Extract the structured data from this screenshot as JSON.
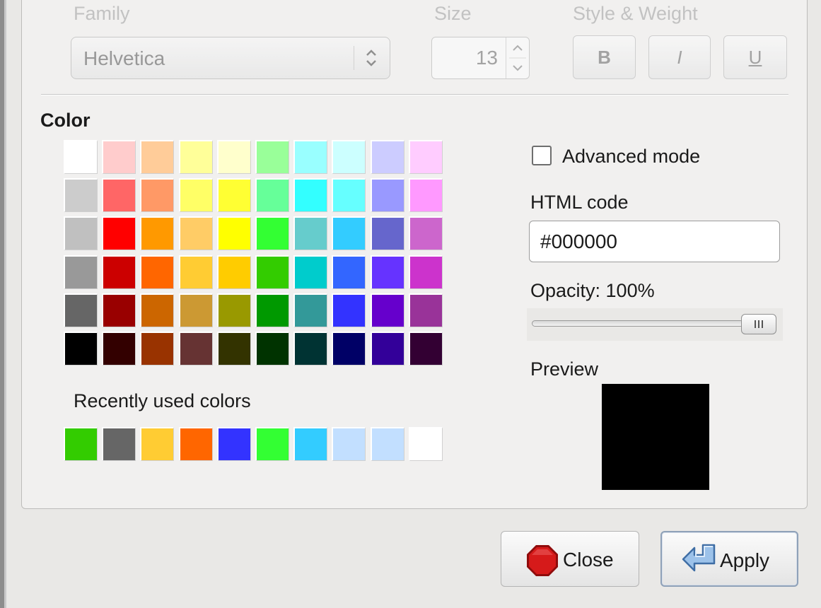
{
  "font": {
    "family_label": "Family",
    "family_value": "Helvetica",
    "size_label": "Size",
    "size_value": "13",
    "style_label": "Style & Weight",
    "bold_label": "B",
    "italic_label": "I",
    "underline_label": "U"
  },
  "color": {
    "heading": "Color",
    "palette": [
      [
        "#ffffff",
        "#ffcccc",
        "#ffcc99",
        "#ffff99",
        "#ffffcc",
        "#99ff99",
        "#99ffff",
        "#ccffff",
        "#ccccff",
        "#ffccff"
      ],
      [
        "#cccccc",
        "#ff6666",
        "#ff9966",
        "#ffff66",
        "#ffff33",
        "#66ff99",
        "#33ffff",
        "#66ffff",
        "#9999ff",
        "#ff99ff"
      ],
      [
        "#c0c0c0",
        "#ff0000",
        "#ff9900",
        "#ffcc66",
        "#ffff00",
        "#33ff33",
        "#66cccc",
        "#33ccff",
        "#6666cc",
        "#cc66cc"
      ],
      [
        "#999999",
        "#cc0000",
        "#ff6600",
        "#ffcc33",
        "#ffcc00",
        "#33cc00",
        "#00cccc",
        "#3366ff",
        "#6633ff",
        "#cc33cc"
      ],
      [
        "#666666",
        "#990000",
        "#cc6600",
        "#cc9933",
        "#999900",
        "#009900",
        "#339999",
        "#3333ff",
        "#6600cc",
        "#993399"
      ],
      [
        "#000000",
        "#330000",
        "#993300",
        "#663333",
        "#333300",
        "#003300",
        "#003333",
        "#000066",
        "#330099",
        "#330033"
      ]
    ],
    "recent_label": "Recently used colors",
    "recent": [
      "#33cc00",
      "#666666",
      "#ffcc33",
      "#ff6600",
      "#3333ff",
      "#33ff33",
      "#33ccff",
      "#c2dfff",
      "#c2dfff",
      "#ffffff"
    ],
    "advanced_label": "Advanced mode",
    "advanced_checked": false,
    "html_code_label": "HTML code",
    "html_code_value": "#000000",
    "opacity_label": "Opacity: 100%",
    "opacity_value": 1.0,
    "preview_label": "Preview",
    "preview_color": "#000000"
  },
  "buttons": {
    "close_label": "Close",
    "apply_label": "Apply"
  },
  "icons": {
    "close": "stop-sign-icon",
    "apply": "apply-arrow-icon"
  }
}
